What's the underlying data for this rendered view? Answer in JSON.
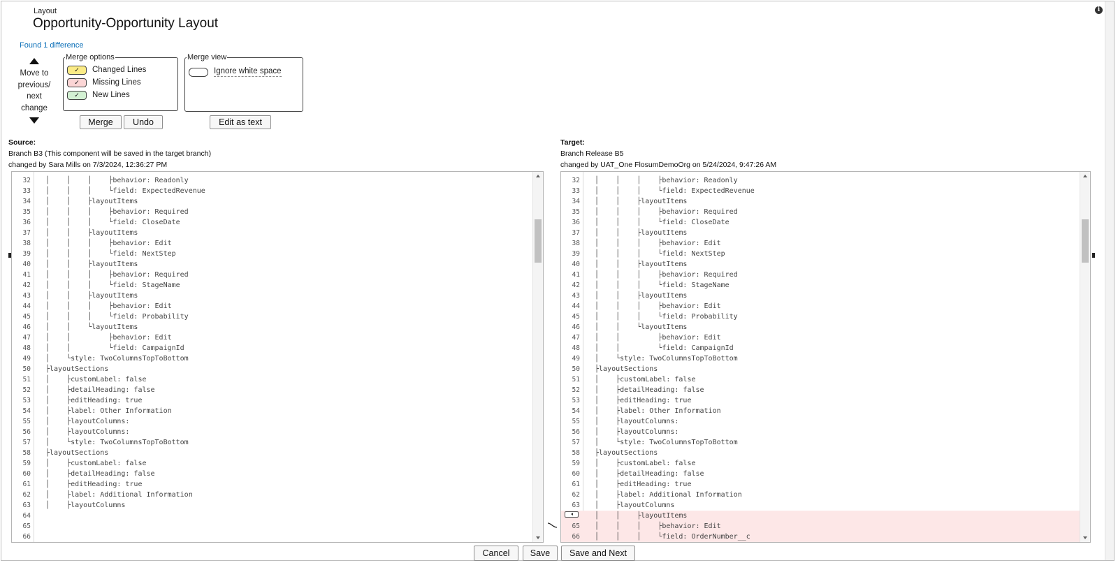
{
  "header": {
    "eyebrow": "Layout",
    "title": "Opportunity-Opportunity Layout",
    "found_differences": "Found 1 difference"
  },
  "navigation": {
    "text_line1": "Move to",
    "text_line2": "previous/",
    "text_line3": "next change"
  },
  "merge_options": {
    "legend": "Merge options",
    "changed": "Changed Lines",
    "missing": "Missing Lines",
    "new": "New Lines",
    "check": "✓",
    "colors": {
      "changed": "#fbeb86",
      "missing": "#fbd5d5",
      "new": "#d3f1d3"
    }
  },
  "merge_view": {
    "legend": "Merge view",
    "ignore_whitespace": "Ignore white space"
  },
  "buttons": {
    "merge": "Merge",
    "undo": "Undo",
    "edit_as_text": "Edit as text",
    "cancel": "Cancel",
    "save": "Save",
    "save_and_next": "Save and Next"
  },
  "source": {
    "heading": "Source:",
    "branch": "Branch B3 (This component will be saved in the target branch)",
    "changed_by": "changed by Sara Mills on 7/3/2024, 12:36:27 PM",
    "lines": [
      {
        "n": "32",
        "code": "│    │    │    ├behavior: Readonly"
      },
      {
        "n": "33",
        "code": "│    │    │    └field: ExpectedRevenue"
      },
      {
        "n": "34",
        "code": "│    │    ├layoutItems"
      },
      {
        "n": "35",
        "code": "│    │    │    ├behavior: Required"
      },
      {
        "n": "36",
        "code": "│    │    │    └field: CloseDate"
      },
      {
        "n": "37",
        "code": "│    │    ├layoutItems"
      },
      {
        "n": "38",
        "code": "│    │    │    ├behavior: Edit"
      },
      {
        "n": "39",
        "code": "│    │    │    └field: NextStep"
      },
      {
        "n": "40",
        "code": "│    │    ├layoutItems"
      },
      {
        "n": "41",
        "code": "│    │    │    ├behavior: Required"
      },
      {
        "n": "42",
        "code": "│    │    │    └field: StageName"
      },
      {
        "n": "43",
        "code": "│    │    ├layoutItems"
      },
      {
        "n": "44",
        "code": "│    │    │    ├behavior: Edit"
      },
      {
        "n": "45",
        "code": "│    │    │    └field: Probability"
      },
      {
        "n": "46",
        "code": "│    │    └layoutItems"
      },
      {
        "n": "47",
        "code": "│    │         ├behavior: Edit"
      },
      {
        "n": "48",
        "code": "│    │         └field: CampaignId"
      },
      {
        "n": "49",
        "code": "│    └style: TwoColumnsTopToBottom"
      },
      {
        "n": "50",
        "code": "├layoutSections"
      },
      {
        "n": "51",
        "code": "│    ├customLabel: false"
      },
      {
        "n": "52",
        "code": "│    ├detailHeading: false"
      },
      {
        "n": "53",
        "code": "│    ├editHeading: true"
      },
      {
        "n": "54",
        "code": "│    ├label: Other Information"
      },
      {
        "n": "55",
        "code": "│    ├layoutColumns:"
      },
      {
        "n": "56",
        "code": "│    ├layoutColumns:"
      },
      {
        "n": "57",
        "code": "│    └style: TwoColumnsTopToBottom"
      },
      {
        "n": "58",
        "code": "├layoutSections"
      },
      {
        "n": "59",
        "code": "│    ├customLabel: false"
      },
      {
        "n": "60",
        "code": "│    ├detailHeading: false"
      },
      {
        "n": "61",
        "code": "│    ├editHeading: true"
      },
      {
        "n": "62",
        "code": "│    ├label: Additional Information"
      },
      {
        "n": "63",
        "code": "│    ├layoutColumns"
      },
      {
        "n": "64",
        "code": ""
      },
      {
        "n": "65",
        "code": ""
      },
      {
        "n": "66",
        "code": ""
      }
    ]
  },
  "target": {
    "heading": "Target:",
    "branch": "Branch Release B5",
    "changed_by": "changed by UAT_One FlosumDemoOrg on 5/24/2024, 9:47:26 AM",
    "lines": [
      {
        "n": "32",
        "code": "│    │    │    ├behavior: Readonly"
      },
      {
        "n": "33",
        "code": "│    │    │    └field: ExpectedRevenue"
      },
      {
        "n": "34",
        "code": "│    │    ├layoutItems"
      },
      {
        "n": "35",
        "code": "│    │    │    ├behavior: Required"
      },
      {
        "n": "36",
        "code": "│    │    │    └field: CloseDate"
      },
      {
        "n": "37",
        "code": "│    │    ├layoutItems"
      },
      {
        "n": "38",
        "code": "│    │    │    ├behavior: Edit"
      },
      {
        "n": "39",
        "code": "│    │    │    └field: NextStep"
      },
      {
        "n": "40",
        "code": "│    │    ├layoutItems"
      },
      {
        "n": "41",
        "code": "│    │    │    ├behavior: Required"
      },
      {
        "n": "42",
        "code": "│    │    │    └field: StageName"
      },
      {
        "n": "43",
        "code": "│    │    ├layoutItems"
      },
      {
        "n": "44",
        "code": "│    │    │    ├behavior: Edit"
      },
      {
        "n": "45",
        "code": "│    │    │    └field: Probability"
      },
      {
        "n": "46",
        "code": "│    │    └layoutItems"
      },
      {
        "n": "47",
        "code": "│    │         ├behavior: Edit"
      },
      {
        "n": "48",
        "code": "│    │         └field: CampaignId"
      },
      {
        "n": "49",
        "code": "│    └style: TwoColumnsTopToBottom"
      },
      {
        "n": "50",
        "code": "├layoutSections"
      },
      {
        "n": "51",
        "code": "│    ├customLabel: false"
      },
      {
        "n": "52",
        "code": "│    ├detailHeading: false"
      },
      {
        "n": "53",
        "code": "│    ├editHeading: true"
      },
      {
        "n": "54",
        "code": "│    ├label: Other Information"
      },
      {
        "n": "55",
        "code": "│    ├layoutColumns:"
      },
      {
        "n": "56",
        "code": "│    ├layoutColumns:"
      },
      {
        "n": "57",
        "code": "│    └style: TwoColumnsTopToBottom"
      },
      {
        "n": "58",
        "code": "├layoutSections"
      },
      {
        "n": "59",
        "code": "│    ├customLabel: false"
      },
      {
        "n": "60",
        "code": "│    ├detailHeading: false"
      },
      {
        "n": "61",
        "code": "│    ├editHeading: true"
      },
      {
        "n": "62",
        "code": "│    ├label: Additional Information"
      },
      {
        "n": "63",
        "code": "│    ├layoutColumns"
      },
      {
        "n": "",
        "code": "│    │    ├layoutItems",
        "missing": true
      },
      {
        "n": "65",
        "code": "│    │    │    ├behavior: Edit",
        "missing": true
      },
      {
        "n": "66",
        "code": "│    │    │    └field: OrderNumber__c",
        "missing": true
      }
    ]
  }
}
